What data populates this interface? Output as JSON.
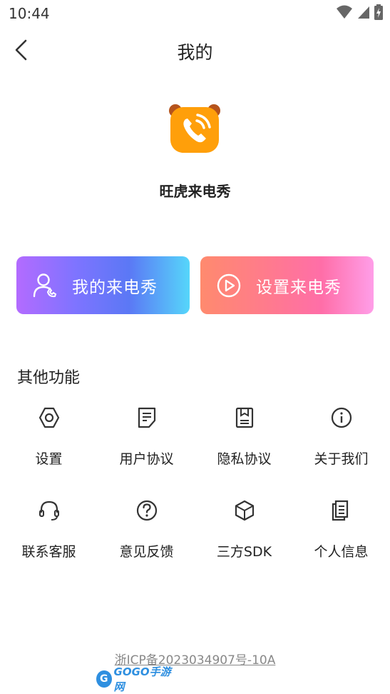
{
  "status_bar": {
    "time": "10:44"
  },
  "nav": {
    "title": "我的"
  },
  "app": {
    "name": "旺虎来电秀"
  },
  "cards": [
    {
      "label": "我的来电秀"
    },
    {
      "label": "设置来电秀"
    }
  ],
  "section": {
    "title": "其他功能"
  },
  "features": [
    {
      "label": "设置",
      "icon": "settings-icon"
    },
    {
      "label": "用户协议",
      "icon": "document-icon"
    },
    {
      "label": "隐私协议",
      "icon": "privacy-doc-icon"
    },
    {
      "label": "关于我们",
      "icon": "info-icon"
    },
    {
      "label": "联系客服",
      "icon": "headset-icon"
    },
    {
      "label": "意见反馈",
      "icon": "question-icon"
    },
    {
      "label": "三方SDK",
      "icon": "cube-icon"
    },
    {
      "label": "个人信息",
      "icon": "file-stack-icon"
    }
  ],
  "footer": {
    "icp": "浙ICP备2023034907号-10A"
  },
  "watermark": {
    "text": "GOGO手游网"
  },
  "colors": {
    "logo_orange": "#ff9f0a",
    "logo_ears": "#b5531c"
  }
}
